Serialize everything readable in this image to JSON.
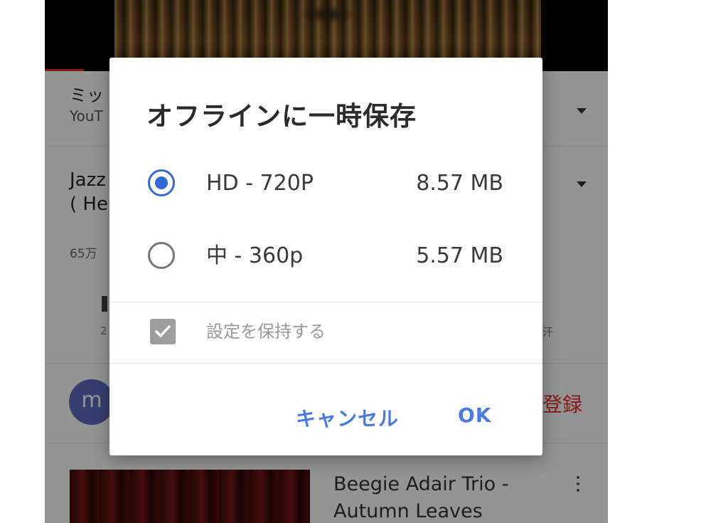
{
  "background_screen": {
    "channel_row": {
      "title": "ミッ",
      "subtitle": "YouT"
    },
    "video": {
      "title_line1": "Jazz",
      "title_line2": "( He",
      "meta": "65万"
    },
    "actions": {
      "left_count": "2",
      "right_label": "汗"
    },
    "channel_avatar_letter": "m",
    "subscribe_label": "登録",
    "recommended": {
      "title_line1": "Beegie Adair Trio -",
      "title_line2": "Autumn Leaves"
    }
  },
  "dialog": {
    "title": "オフラインに一時保存",
    "options": [
      {
        "label": "HD - 720P",
        "size": "8.57 MB",
        "selected": true
      },
      {
        "label": "中 - 360p",
        "size": "5.57 MB",
        "selected": false
      }
    ],
    "remember_setting": {
      "label": "設定を保持する",
      "checked": true
    },
    "buttons": {
      "cancel": "キャンセル",
      "ok": "OK"
    }
  },
  "colors": {
    "accent": "#3367d6",
    "button_text": "#4a7be0",
    "subscribe": "#e52d27",
    "avatar": "#5c6bc0"
  }
}
